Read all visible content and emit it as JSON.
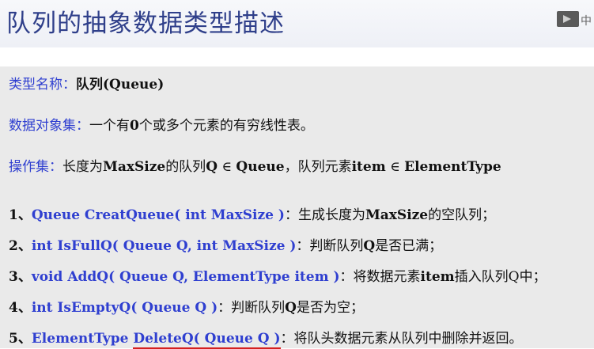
{
  "title": "队列的抽象数据类型描述",
  "corner_badge": "中",
  "definition": {
    "type_name": {
      "label": "类型名称：",
      "value": "队列(Queue)"
    },
    "data_objects": {
      "label": "数据对象集：",
      "value_pre": "一个有",
      "zero": "0",
      "value_post": "个或多个元素的有穷线性表。"
    },
    "operations": {
      "label": "操作集：",
      "p1": "长度为",
      "maxsize": "MaxSize",
      "p2": "的队列",
      "q": "Q",
      "elem_of": "∈",
      "queue": "Queue",
      "p3": "，队列元素",
      "item": "item",
      "elem_of2": "∈",
      "elemtype": "ElementType"
    }
  },
  "operations": [
    {
      "num": "1、",
      "sig": "Queue CreatQueue( int MaxSize )",
      "colon": "：",
      "desc_a": "生成长度为",
      "desc_b": "MaxSize",
      "desc_c": "的空队列；"
    },
    {
      "num": "2、",
      "sig": "int IsFullQ( Queue Q, int MaxSize )",
      "colon": "：",
      "desc_a": "判断队列",
      "desc_b": "Q",
      "desc_c": "是否已满；"
    },
    {
      "num": "3、",
      "sig": "void AddQ( Queue Q, ElementType item )",
      "colon": "：",
      "desc_a": "将数据元素",
      "desc_b": "item",
      "desc_c": "插入队列Q中；"
    },
    {
      "num": "4、",
      "sig": "int IsEmptyQ( Queue Q )",
      "colon": "：",
      "desc_a": "判断队列",
      "desc_b": "Q",
      "desc_c": "是否为空；"
    },
    {
      "num": "5、",
      "sig_a": "ElementType ",
      "sig_b": "DeleteQ( Queue Q )",
      "colon": "：",
      "desc_a": "将队头数据元素从队列中删除并返回。"
    }
  ],
  "colors": {
    "title": "#2f3f8a",
    "keyword": "#2f3fd0",
    "underline": "#d42020"
  }
}
